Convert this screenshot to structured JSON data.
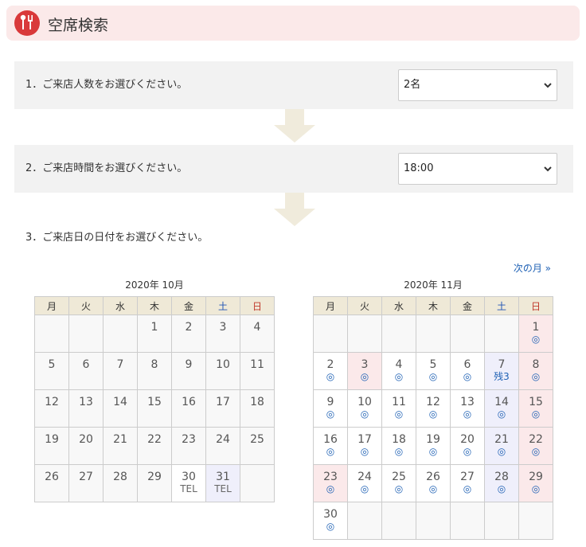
{
  "header": {
    "title": "空席検索"
  },
  "steps": [
    {
      "label": "1．ご来店人数をお選びください。",
      "value": "2名"
    },
    {
      "label": "2．ご来店時間をお選びください。",
      "value": "18:00"
    },
    {
      "label": "3．ご来店日の日付をお選びください。"
    }
  ],
  "next_month": "次の月 »",
  "weekdays": [
    "月",
    "火",
    "水",
    "木",
    "金",
    "土",
    "日"
  ],
  "calendars": [
    {
      "caption": "2020年 10月",
      "weeks": [
        [
          {
            "d": ""
          },
          {
            "d": ""
          },
          {
            "d": ""
          },
          {
            "d": "1"
          },
          {
            "d": "2"
          },
          {
            "d": "3"
          },
          {
            "d": "4"
          }
        ],
        [
          {
            "d": "5"
          },
          {
            "d": "6"
          },
          {
            "d": "7"
          },
          {
            "d": "8"
          },
          {
            "d": "9"
          },
          {
            "d": "10"
          },
          {
            "d": "11"
          }
        ],
        [
          {
            "d": "12"
          },
          {
            "d": "13"
          },
          {
            "d": "14"
          },
          {
            "d": "15"
          },
          {
            "d": "16"
          },
          {
            "d": "17"
          },
          {
            "d": "18"
          }
        ],
        [
          {
            "d": "19"
          },
          {
            "d": "20"
          },
          {
            "d": "21"
          },
          {
            "d": "22"
          },
          {
            "d": "23"
          },
          {
            "d": "24"
          },
          {
            "d": "25"
          }
        ],
        [
          {
            "d": "26"
          },
          {
            "d": "27"
          },
          {
            "d": "28"
          },
          {
            "d": "29"
          },
          {
            "d": "30",
            "s": "TEL",
            "bg": "avail"
          },
          {
            "d": "31",
            "s": "TEL",
            "bg": "sat"
          },
          {
            "d": ""
          }
        ]
      ]
    },
    {
      "caption": "2020年 11月",
      "weeks": [
        [
          {
            "d": ""
          },
          {
            "d": ""
          },
          {
            "d": ""
          },
          {
            "d": ""
          },
          {
            "d": ""
          },
          {
            "d": ""
          },
          {
            "d": "1",
            "s": "◎",
            "bg": "sun"
          }
        ],
        [
          {
            "d": "2",
            "s": "◎",
            "bg": "avail"
          },
          {
            "d": "3",
            "s": "◎",
            "bg": "sun"
          },
          {
            "d": "4",
            "s": "◎",
            "bg": "avail"
          },
          {
            "d": "5",
            "s": "◎",
            "bg": "avail"
          },
          {
            "d": "6",
            "s": "◎",
            "bg": "avail"
          },
          {
            "d": "7",
            "s": "残3",
            "bg": "sat"
          },
          {
            "d": "8",
            "s": "◎",
            "bg": "sun"
          }
        ],
        [
          {
            "d": "9",
            "s": "◎",
            "bg": "avail"
          },
          {
            "d": "10",
            "s": "◎",
            "bg": "avail"
          },
          {
            "d": "11",
            "s": "◎",
            "bg": "avail"
          },
          {
            "d": "12",
            "s": "◎",
            "bg": "avail"
          },
          {
            "d": "13",
            "s": "◎",
            "bg": "avail"
          },
          {
            "d": "14",
            "s": "◎",
            "bg": "sat"
          },
          {
            "d": "15",
            "s": "◎",
            "bg": "sun"
          }
        ],
        [
          {
            "d": "16",
            "s": "◎",
            "bg": "avail"
          },
          {
            "d": "17",
            "s": "◎",
            "bg": "avail"
          },
          {
            "d": "18",
            "s": "◎",
            "bg": "avail"
          },
          {
            "d": "19",
            "s": "◎",
            "bg": "avail"
          },
          {
            "d": "20",
            "s": "◎",
            "bg": "avail"
          },
          {
            "d": "21",
            "s": "◎",
            "bg": "sat"
          },
          {
            "d": "22",
            "s": "◎",
            "bg": "sun"
          }
        ],
        [
          {
            "d": "23",
            "s": "◎",
            "bg": "sun"
          },
          {
            "d": "24",
            "s": "◎",
            "bg": "avail"
          },
          {
            "d": "25",
            "s": "◎",
            "bg": "avail"
          },
          {
            "d": "26",
            "s": "◎",
            "bg": "avail"
          },
          {
            "d": "27",
            "s": "◎",
            "bg": "avail"
          },
          {
            "d": "28",
            "s": "◎",
            "bg": "sat"
          },
          {
            "d": "29",
            "s": "◎",
            "bg": "sun"
          }
        ],
        [
          {
            "d": "30",
            "s": "◎",
            "bg": "avail"
          },
          {
            "d": ""
          },
          {
            "d": ""
          },
          {
            "d": ""
          },
          {
            "d": ""
          },
          {
            "d": ""
          },
          {
            "d": ""
          }
        ]
      ]
    }
  ],
  "colors": {
    "brand_red": "#d9393a",
    "header_bg": "#fbe9e9",
    "link_blue": "#2062b5",
    "saturday_bg": "#efeffb",
    "sunday_bg": "#fbe9ea",
    "weekday_header_bg": "#efe9d7"
  }
}
